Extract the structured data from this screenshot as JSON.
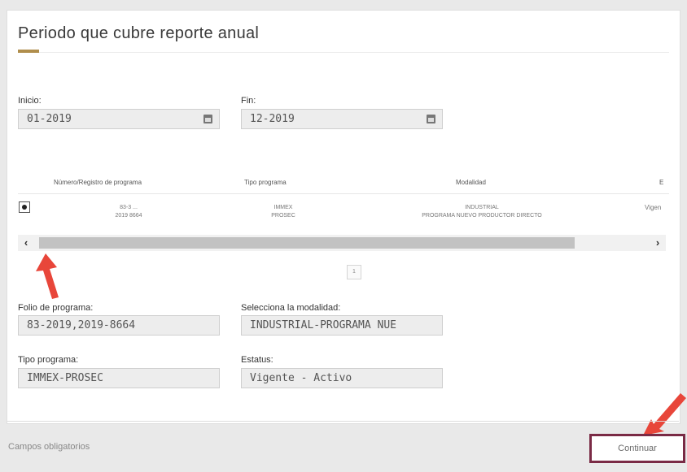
{
  "page": {
    "title": "Periodo que cubre reporte anual",
    "accent_color": "#b08e4c"
  },
  "period": {
    "start_label": "Inicio:",
    "start_value": "01-2019",
    "end_label": "Fin:",
    "end_value": "12-2019"
  },
  "table": {
    "headers": [
      "Número/Registro de programa",
      "Tipo programa",
      "Modalidad",
      "E"
    ],
    "row": {
      "selected": true,
      "registro_line1": "83-3 ...",
      "registro_line2": "2019 8664",
      "tipo_line1": "IMMEX",
      "tipo_line2": "PROSEC",
      "modalidad_line1": "INDUSTRIAL",
      "modalidad_line2": "PROGRAMA NUEVO PRODUCTOR DIRECTO",
      "estatus": "Vigen"
    },
    "scroll_left": "‹",
    "scroll_right": "›",
    "page_number": "1"
  },
  "details": {
    "folio_label": "Folio de programa:",
    "folio_value": "83-2019,2019-8664",
    "modalidad_label": "Selecciona la modalidad:",
    "modalidad_value": "INDUSTRIAL-PROGRAMA NUE",
    "tipo_label": "Tipo programa:",
    "tipo_value": "IMMEX-PROSEC",
    "estatus_label": "Estatus:",
    "estatus_value": "Vigente - Activo"
  },
  "footer": {
    "required_text": "Campos obligatorios",
    "continue_label": "Continuar",
    "highlight_color": "#7a2a45"
  },
  "annotations": {
    "arrow_color": "#e8463a"
  },
  "icons": {
    "calendar": "calendar-icon",
    "arrow": "red-arrow-icon"
  }
}
